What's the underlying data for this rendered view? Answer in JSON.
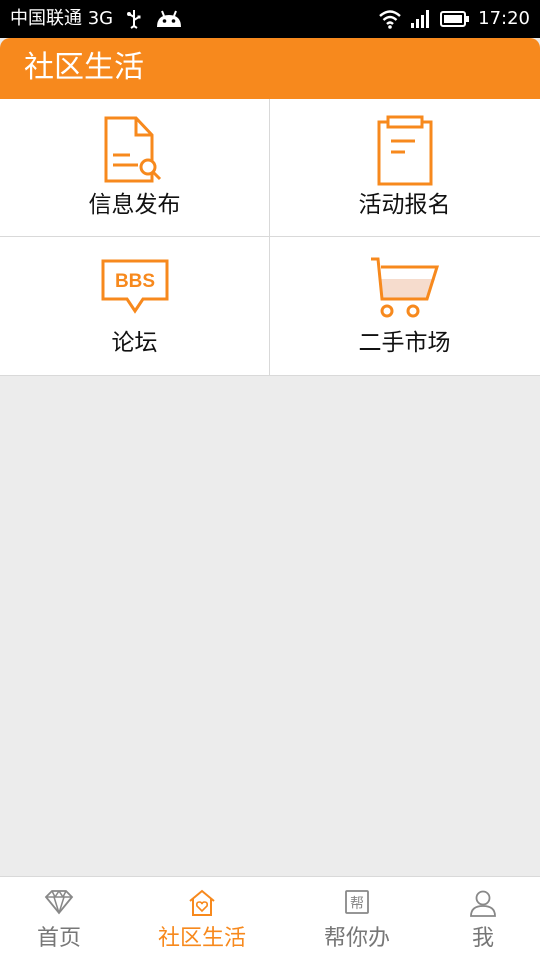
{
  "status_bar": {
    "carrier": "中国联通 3G",
    "time": "17:20"
  },
  "header": {
    "title": "社区生活"
  },
  "grid": {
    "items": [
      {
        "label": "信息发布",
        "icon": "document-search-icon"
      },
      {
        "label": "活动报名",
        "icon": "clipboard-icon"
      },
      {
        "label": "论坛",
        "icon": "bbs-icon",
        "icon_text": "BBS"
      },
      {
        "label": "二手市场",
        "icon": "shopping-cart-icon"
      }
    ]
  },
  "bottom_nav": {
    "items": [
      {
        "label": "首页",
        "icon": "diamond-icon",
        "active": false
      },
      {
        "label": "社区生活",
        "icon": "home-heart-icon",
        "active": true
      },
      {
        "label": "帮你办",
        "icon": "help-icon",
        "icon_text": "帮",
        "active": false
      },
      {
        "label": "我",
        "icon": "user-icon",
        "active": false
      }
    ]
  },
  "colors": {
    "accent": "#f7891d",
    "status_bar_bg": "#000000",
    "page_bg": "#ececec",
    "inactive_nav": "#777777"
  }
}
